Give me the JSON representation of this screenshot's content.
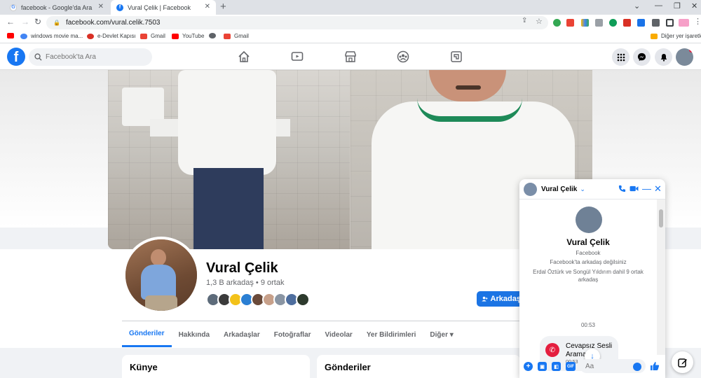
{
  "browser": {
    "tabs": [
      {
        "title": "facebook - Google'da Ara",
        "active": false
      },
      {
        "title": "Vural Çelik | Facebook",
        "active": true
      }
    ],
    "url": "facebook.com/vural.celik.7503",
    "bookmarks": [
      "windows movie ma...",
      "e-Devlet Kapısı",
      "Gmail",
      "YouTube",
      "Gmail"
    ],
    "other_bookmarks": "Diğer yer işaretle"
  },
  "facebook": {
    "logo": "f",
    "search_placeholder": "Facebook'ta Ara"
  },
  "profile": {
    "name": "Vural Çelik",
    "friends_text": "1,3 B arkadaş • 9 ortak",
    "add_friend_label": "Arkadaşı",
    "tabs": [
      "Gönderiler",
      "Hakkında",
      "Arkadaşlar",
      "Fotoğraflar",
      "Videolar",
      "Yer Bildirimleri",
      "Diğer ▾"
    ],
    "active_tab": "Gönderiler",
    "cards": [
      "Künye",
      "Gönderiler"
    ]
  },
  "chat": {
    "header_name": "Vural Çelik",
    "name": "Vural Çelik",
    "platform": "Facebook",
    "not_friends": "Facebook'ta arkadaş değilsiniz",
    "mutual": "Erdal Öztürk ve Songül Yıldırım dahil 9 ortak arkadaş",
    "time": "00:53",
    "call_text": "Cevapsız Sesli Arama",
    "call_time": "00:53",
    "input_placeholder": "Aa",
    "gif_label": "GIF"
  },
  "colors": {
    "facebook_blue": "#1877f2",
    "missed_call": "#e41e3f"
  }
}
